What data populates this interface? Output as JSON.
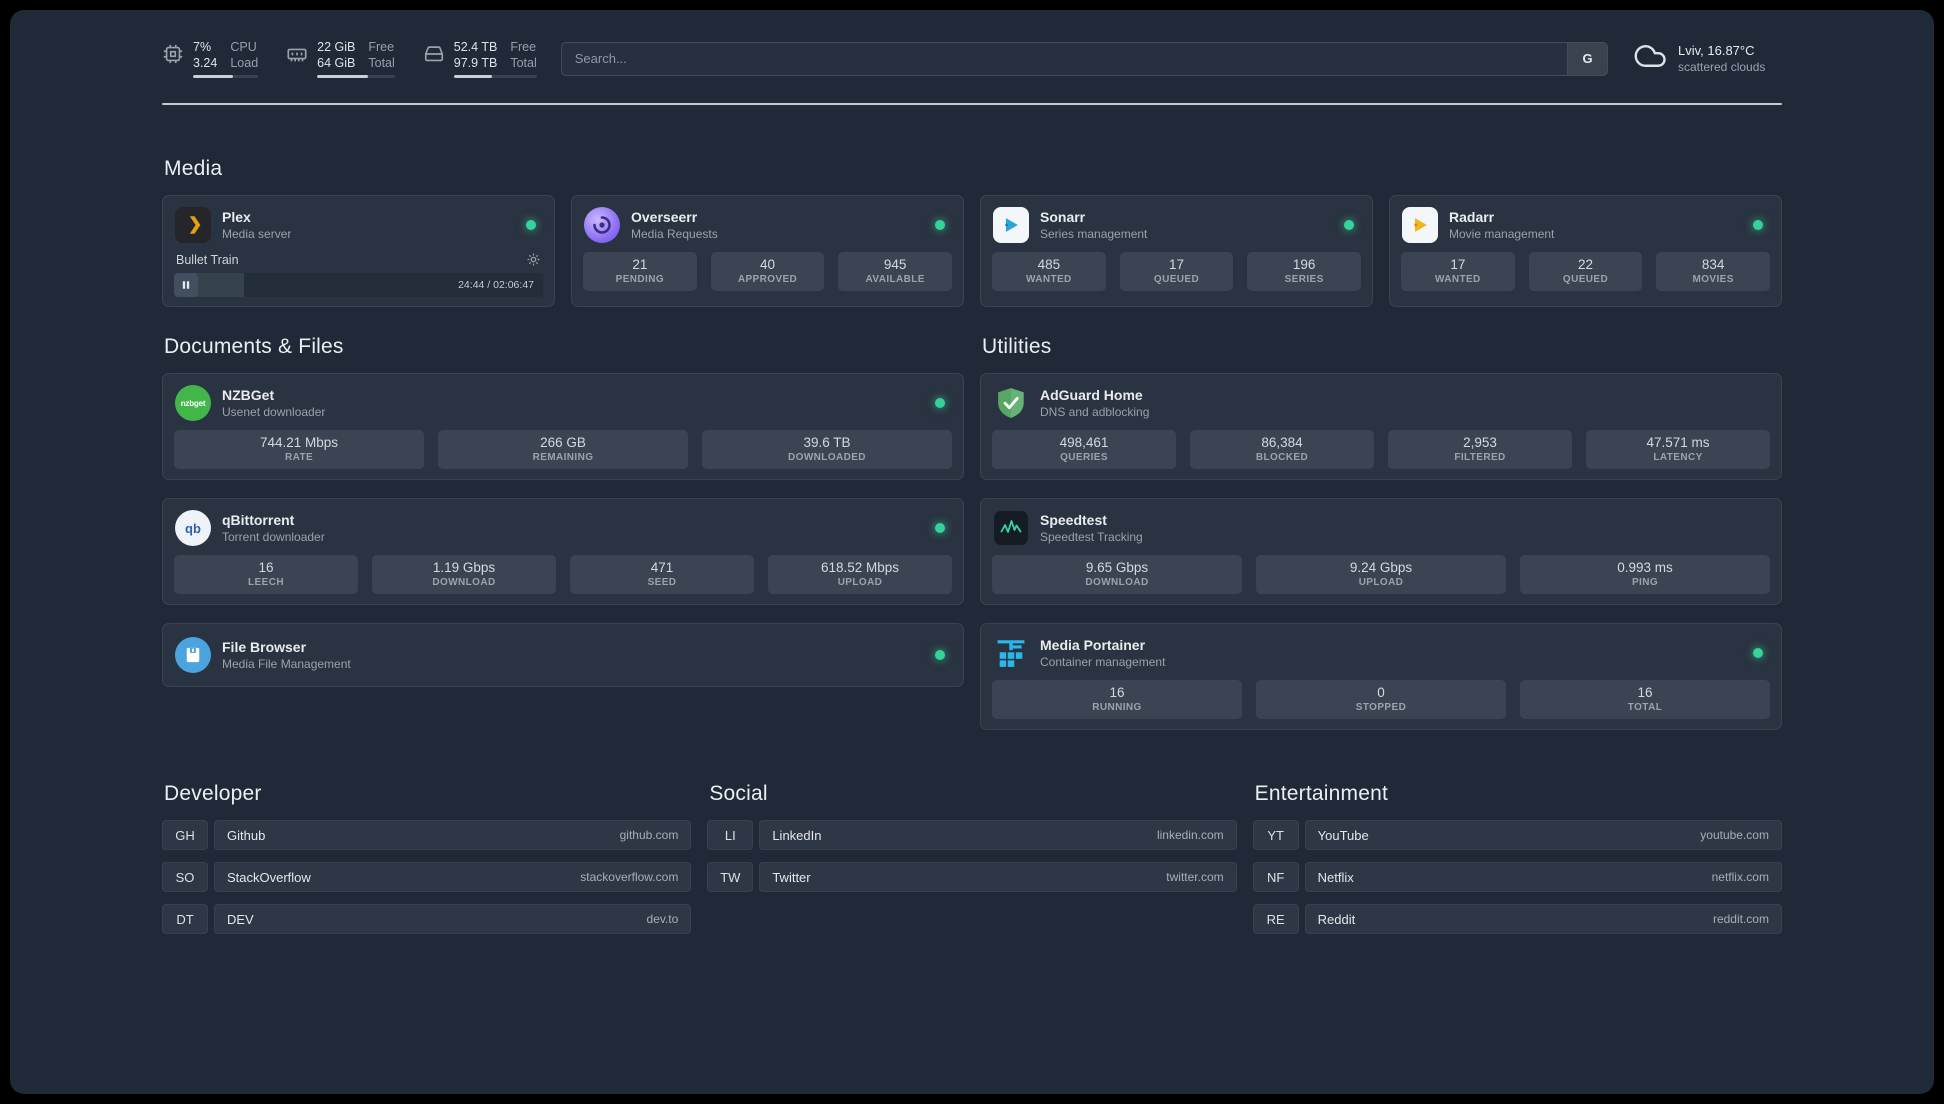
{
  "colors": {
    "status_online": "#34d399",
    "background": "#1f2938",
    "card": "#2a3341",
    "stat_block": "#3a4452"
  },
  "topbar": {
    "resources": [
      {
        "id": "cpu",
        "icon": "cpu-icon",
        "values": [
          "7%",
          "3.24"
        ],
        "labels": [
          "CPU",
          "Load"
        ],
        "percent": 62
      },
      {
        "id": "memory",
        "icon": "memory-icon",
        "values": [
          "22 GiB",
          "64 GiB"
        ],
        "labels": [
          "Free",
          "Total"
        ],
        "percent": 65
      },
      {
        "id": "disk",
        "icon": "disk-icon",
        "values": [
          "52.4 TB",
          "97.9 TB"
        ],
        "labels": [
          "Free",
          "Total"
        ],
        "percent": 46
      }
    ],
    "search": {
      "placeholder": "Search...",
      "button_label": "G"
    },
    "weather": {
      "icon": "cloud-icon",
      "location": "Lviv, 16.87°C",
      "condition": "scattered clouds"
    }
  },
  "service_groups": [
    {
      "title": "Media",
      "services": [
        {
          "icon": "plex",
          "name": "Plex",
          "description": "Media server",
          "online": true,
          "player": {
            "track": "Bullet Train",
            "time": "24:44 / 02:06:47",
            "progress_percent": 19
          }
        },
        {
          "icon": "overseerr",
          "name": "Overseerr",
          "description": "Media Requests",
          "online": true,
          "stats": [
            {
              "value": "21",
              "label": "PENDING"
            },
            {
              "value": "40",
              "label": "APPROVED"
            },
            {
              "value": "945",
              "label": "AVAILABLE"
            }
          ]
        },
        {
          "icon": "sonarr",
          "name": "Sonarr",
          "description": "Series management",
          "online": true,
          "stats": [
            {
              "value": "485",
              "label": "WANTED"
            },
            {
              "value": "17",
              "label": "QUEUED"
            },
            {
              "value": "196",
              "label": "SERIES"
            }
          ]
        },
        {
          "icon": "radarr",
          "name": "Radarr",
          "description": "Movie management",
          "online": true,
          "stats": [
            {
              "value": "17",
              "label": "WANTED"
            },
            {
              "value": "22",
              "label": "QUEUED"
            },
            {
              "value": "834",
              "label": "MOVIES"
            }
          ]
        }
      ]
    },
    {
      "title": "Documents & Files",
      "services": [
        {
          "icon": "nzbget",
          "name": "NZBGet",
          "description": "Usenet downloader",
          "online": true,
          "stats": [
            {
              "value": "744.21 Mbps",
              "label": "RATE"
            },
            {
              "value": "266 GB",
              "label": "REMAINING"
            },
            {
              "value": "39.6 TB",
              "label": "DOWNLOADED"
            }
          ]
        },
        {
          "icon": "qbittorrent",
          "name": "qBittorrent",
          "description": "Torrent downloader",
          "online": true,
          "stats": [
            {
              "value": "16",
              "label": "LEECH"
            },
            {
              "value": "1.19 Gbps",
              "label": "DOWNLOAD"
            },
            {
              "value": "471",
              "label": "SEED"
            },
            {
              "value": "618.52 Mbps",
              "label": "UPLOAD"
            }
          ]
        },
        {
          "icon": "filebrowser",
          "name": "File Browser",
          "description": "Media File Management",
          "online": true
        }
      ]
    },
    {
      "title": "Utilities",
      "services": [
        {
          "icon": "adguard",
          "name": "AdGuard Home",
          "description": "DNS and adblocking",
          "online": false,
          "stats": [
            {
              "value": "498,461",
              "label": "QUERIES"
            },
            {
              "value": "86,384",
              "label": "BLOCKED"
            },
            {
              "value": "2,953",
              "label": "FILTERED"
            },
            {
              "value": "47.571 ms",
              "label": "LATENCY"
            }
          ]
        },
        {
          "icon": "speedtest",
          "name": "Speedtest",
          "description": "Speedtest Tracking",
          "online": false,
          "stats": [
            {
              "value": "9.65 Gbps",
              "label": "DOWNLOAD"
            },
            {
              "value": "9.24 Gbps",
              "label": "UPLOAD"
            },
            {
              "value": "0.993 ms",
              "label": "PING"
            }
          ]
        },
        {
          "icon": "portainer",
          "name": "Media Portainer",
          "description": "Container management",
          "online": true,
          "stats": [
            {
              "value": "16",
              "label": "RUNNING"
            },
            {
              "value": "0",
              "label": "STOPPED"
            },
            {
              "value": "16",
              "label": "TOTAL"
            }
          ]
        }
      ]
    }
  ],
  "bookmark_groups": [
    {
      "title": "Developer",
      "items": [
        {
          "abbr": "GH",
          "name": "Github",
          "url": "github.com"
        },
        {
          "abbr": "SO",
          "name": "StackOverflow",
          "url": "stackoverflow.com"
        },
        {
          "abbr": "DT",
          "name": "DEV",
          "url": "dev.to"
        }
      ]
    },
    {
      "title": "Social",
      "items": [
        {
          "abbr": "LI",
          "name": "LinkedIn",
          "url": "linkedin.com"
        },
        {
          "abbr": "TW",
          "name": "Twitter",
          "url": "twitter.com"
        }
      ]
    },
    {
      "title": "Entertainment",
      "items": [
        {
          "abbr": "YT",
          "name": "YouTube",
          "url": "youtube.com"
        },
        {
          "abbr": "NF",
          "name": "Netflix",
          "url": "netflix.com"
        },
        {
          "abbr": "RE",
          "name": "Reddit",
          "url": "reddit.com"
        }
      ]
    }
  ]
}
